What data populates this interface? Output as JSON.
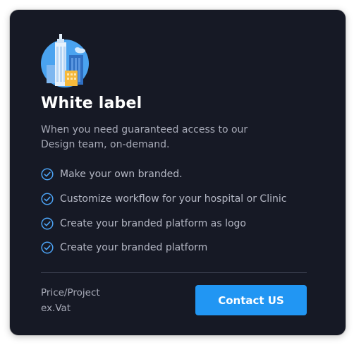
{
  "card": {
    "title": "White label",
    "description": "When you need guaranteed access to our Design team, on-demand.",
    "illustration_icon": "city-buildings-icon",
    "features": [
      {
        "icon": "check-circle-icon",
        "label": "Make your own branded."
      },
      {
        "icon": "check-circle-icon",
        "label": "Customize workflow for your hospital or Clinic"
      },
      {
        "icon": "check-circle-icon",
        "label": "Create your branded platform as logo"
      },
      {
        "icon": "check-circle-icon",
        "label": "Create your branded platform"
      }
    ],
    "price_label": "Price/Project",
    "price_note": "ex.Vat",
    "cta_label": "Contact US"
  },
  "colors": {
    "card_background": "#161925",
    "accent": "#2196f3",
    "check": "#4ca3f5",
    "text_primary": "#ffffff",
    "text_secondary": "#a8abb8"
  }
}
